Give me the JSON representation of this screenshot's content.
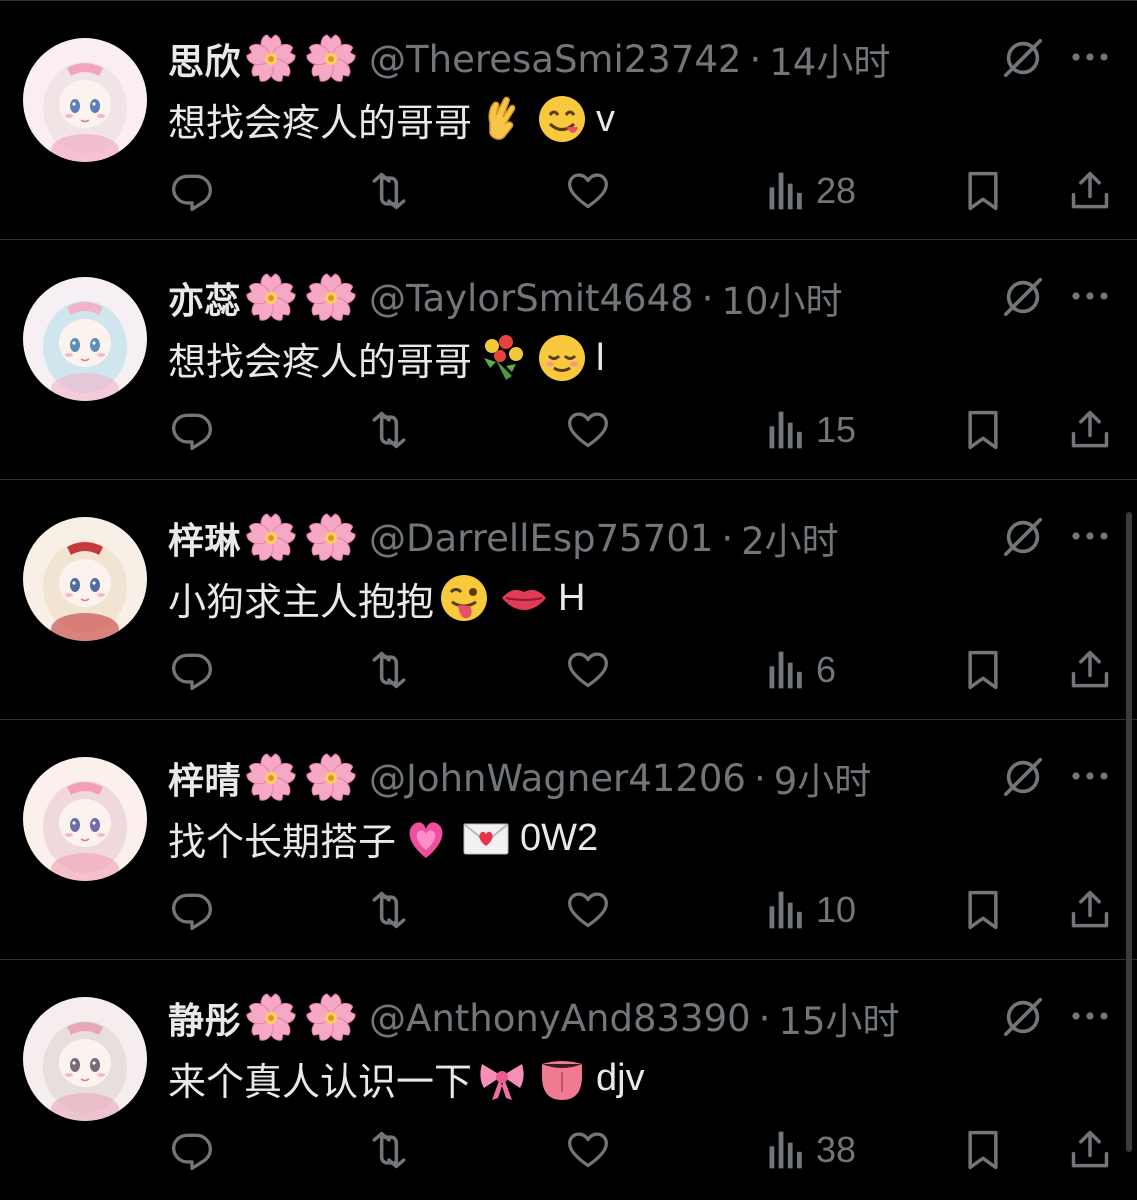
{
  "colors": {
    "background": "#000000",
    "primary_text": "#e7e9ea",
    "secondary_text": "#71767b",
    "divider": "#2f3336"
  },
  "tweets": [
    {
      "name": "思欣",
      "name_emojis": [
        "cherry-blossom",
        "cherry-blossom"
      ],
      "handle": "@TheresaSmi23742",
      "separator": "·",
      "time": "14小时",
      "text": "想找会疼人的哥哥",
      "emojis": [
        "pinching-hand",
        "face-savoring-food"
      ],
      "suffix": "v",
      "views": "28"
    },
    {
      "name": "亦蕊",
      "name_emojis": [
        "cherry-blossom",
        "cherry-blossom"
      ],
      "handle": "@TaylorSmit4648",
      "separator": "·",
      "time": "10小时",
      "text": "想找会疼人的哥哥",
      "emojis": [
        "bouquet",
        "relieved-face"
      ],
      "suffix": "l",
      "views": "15"
    },
    {
      "name": "梓琳",
      "name_emojis": [
        "cherry-blossom",
        "cherry-blossom"
      ],
      "handle": "@DarrellEsp75701",
      "separator": "·",
      "time": "2小时",
      "text": "小狗求主人抱抱",
      "emojis": [
        "winking-face-with-tongue",
        "lips"
      ],
      "suffix": "H",
      "views": "6"
    },
    {
      "name": "梓晴",
      "name_emojis": [
        "cherry-blossom",
        "cherry-blossom"
      ],
      "handle": "@JohnWagner41206",
      "separator": "·",
      "time": "9小时",
      "text": "找个长期搭子",
      "emojis": [
        "growing-heart",
        "love-letter"
      ],
      "suffix": "0W2",
      "views": "10"
    },
    {
      "name": "静彤",
      "name_emojis": [
        "cherry-blossom",
        "cherry-blossom"
      ],
      "handle": "@AnthonyAnd83390",
      "separator": "·",
      "time": "15小时",
      "text": "来个真人认识一下",
      "emojis": [
        "ribbon",
        "tongue"
      ],
      "suffix": "djv",
      "views": "38"
    }
  ],
  "icons": {
    "reply": "reply-icon",
    "retweet": "retweet-icon",
    "like": "heart-icon",
    "views": "views-chart-icon",
    "bookmark": "bookmark-icon",
    "share": "share-icon",
    "grok": "grok-icon",
    "more": "more-icon"
  }
}
